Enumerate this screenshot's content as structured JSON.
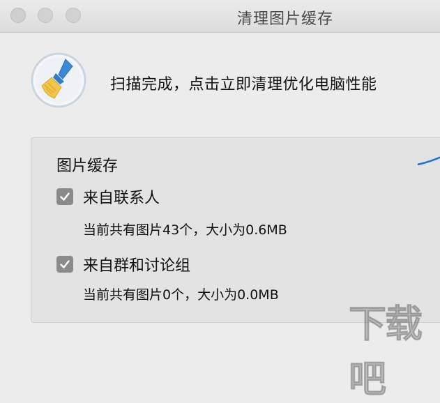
{
  "window": {
    "title": "清理图片缓存"
  },
  "header": {
    "icon": "broom-icon",
    "message": "扫描完成，点击立即清理优化电脑性能"
  },
  "group": {
    "title": "图片缓存",
    "items": [
      {
        "label": "来自联系人",
        "checked": true,
        "detail": "当前共有图片43个，大小为0.6MB"
      },
      {
        "label": "来自群和讨论组",
        "checked": true,
        "detail": "当前共有图片0个，大小为0.0MB"
      }
    ]
  },
  "watermark": "下载吧",
  "colors": {
    "checkbox": "#8a8a8a",
    "icon_ring": "#c8d4e0",
    "broom_handle": "#3a8ad8",
    "broom_bristles": "#f2c64a",
    "accent_line": "#1a6fe0"
  }
}
